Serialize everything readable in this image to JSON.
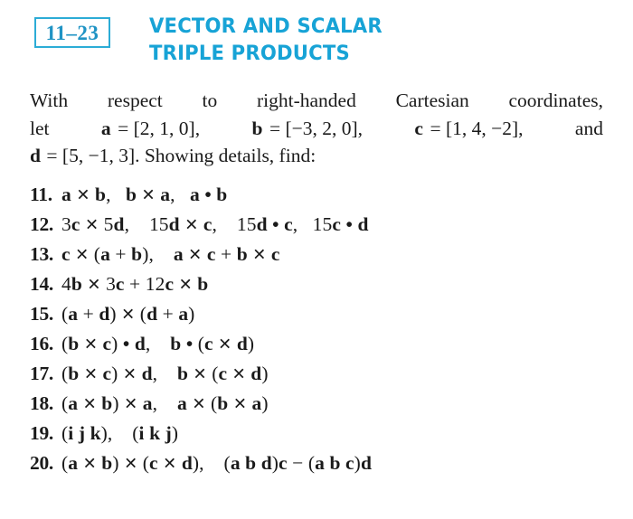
{
  "colors": {
    "title_cyan": "#17a3d6",
    "box_border": "#2cacd6",
    "section_number": "#1f93c4",
    "text": "#1a1a1a",
    "background": "#ffffff"
  },
  "header": {
    "section_number": "11–23",
    "title_line1": "VECTOR AND SCALAR",
    "title_line2": "TRIPLE PRODUCTS"
  },
  "intro": {
    "line1": [
      "With",
      "respect",
      "to",
      "right-handed",
      "Cartesian",
      "coordinates,"
    ],
    "line2": [
      "let",
      "𝐚 = [2, 1, 0],",
      "𝐛 = [−3, 2, 0],",
      "𝐜 = [1, 4, −2],",
      "and"
    ],
    "line2_parts": [
      {
        "text": "let",
        "bold": false
      },
      {
        "text": "a",
        "bold": true
      },
      {
        "text": "= [2, 1, 0],",
        "bold": false
      },
      {
        "text": "b",
        "bold": true
      },
      {
        "text": "= [−3, 2, 0],",
        "bold": false
      },
      {
        "text": "c",
        "bold": true
      },
      {
        "text": "= [1, 4, −2],",
        "bold": false
      },
      {
        "text": "and",
        "bold": false
      }
    ],
    "line3_parts": [
      {
        "text": "d",
        "bold": true
      },
      {
        "text": "= [5, −1, 3]. Showing details, find:",
        "bold": false
      }
    ]
  },
  "problems": [
    {
      "number": "11.",
      "body": "a ✕ b,   b ✕ a,   a • b"
    },
    {
      "number": "12.",
      "body": "3c ✕ 5d,    15d ✕ c,    15d • c,   15c • d"
    },
    {
      "number": "13.",
      "body": "c ✕ (a + b),    a ✕ c + b ✕ c"
    },
    {
      "number": "14.",
      "body": "4b ✕ 3c + 12c ✕ b"
    },
    {
      "number": "15.",
      "body": "(a + d) ✕ (d + a)"
    },
    {
      "number": "16.",
      "body": "(b ✕ c) • d,    b • (c ✕ d)"
    },
    {
      "number": "17.",
      "body": "(b ✕ c) ✕ d,    b ✕ (c ✕ d)"
    },
    {
      "number": "18.",
      "body": "(a ✕ b) ✕ a,    a ✕ (b ✕ a)"
    },
    {
      "number": "19.",
      "body": "(i j k),    (i k j)"
    },
    {
      "number": "20.",
      "body": "(a ✕ b) ✕ (c ✕ d),    (a b d)c − (a b c)d"
    }
  ]
}
